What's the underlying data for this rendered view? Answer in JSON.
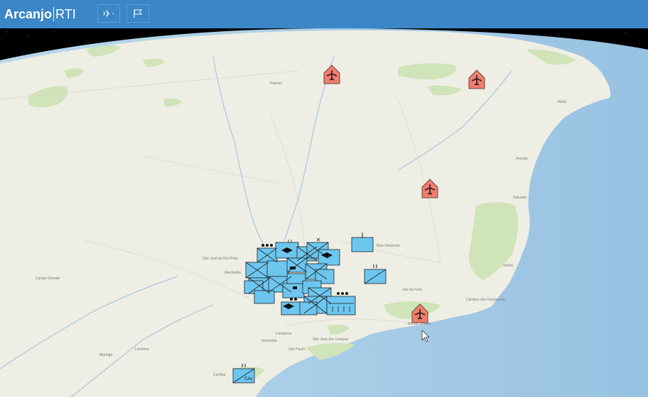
{
  "app": {
    "title_bold": "Arcanjo",
    "title_rest": "RTI"
  },
  "toolbar": [
    {
      "name": "aircraft-tool",
      "icon": "airplane-icon"
    },
    {
      "name": "flag-tool",
      "icon": "flag-icon"
    }
  ],
  "map": {
    "place_labels": [
      "Palmas",
      "Natal",
      "Aracaju",
      "Salvador",
      "Belo Horizonte",
      "Vitória",
      "Rio de Janeiro",
      "São Paulo",
      "Campinas",
      "Campo Grande",
      "Londrina",
      "Maringá",
      "Curitiba",
      "Campos dos Goytacazes",
      "Juiz de Fora",
      "Uberlândia",
      "São José do Rio Preto",
      "Sorocaba",
      "São José dos Campos"
    ],
    "unit_label": "CAv"
  },
  "colors": {
    "header": "#3a86c6",
    "hostile": "#f47c6c",
    "friendly": "#6cc6ef",
    "sea": "#a7cde8",
    "land": "#efeee6"
  }
}
